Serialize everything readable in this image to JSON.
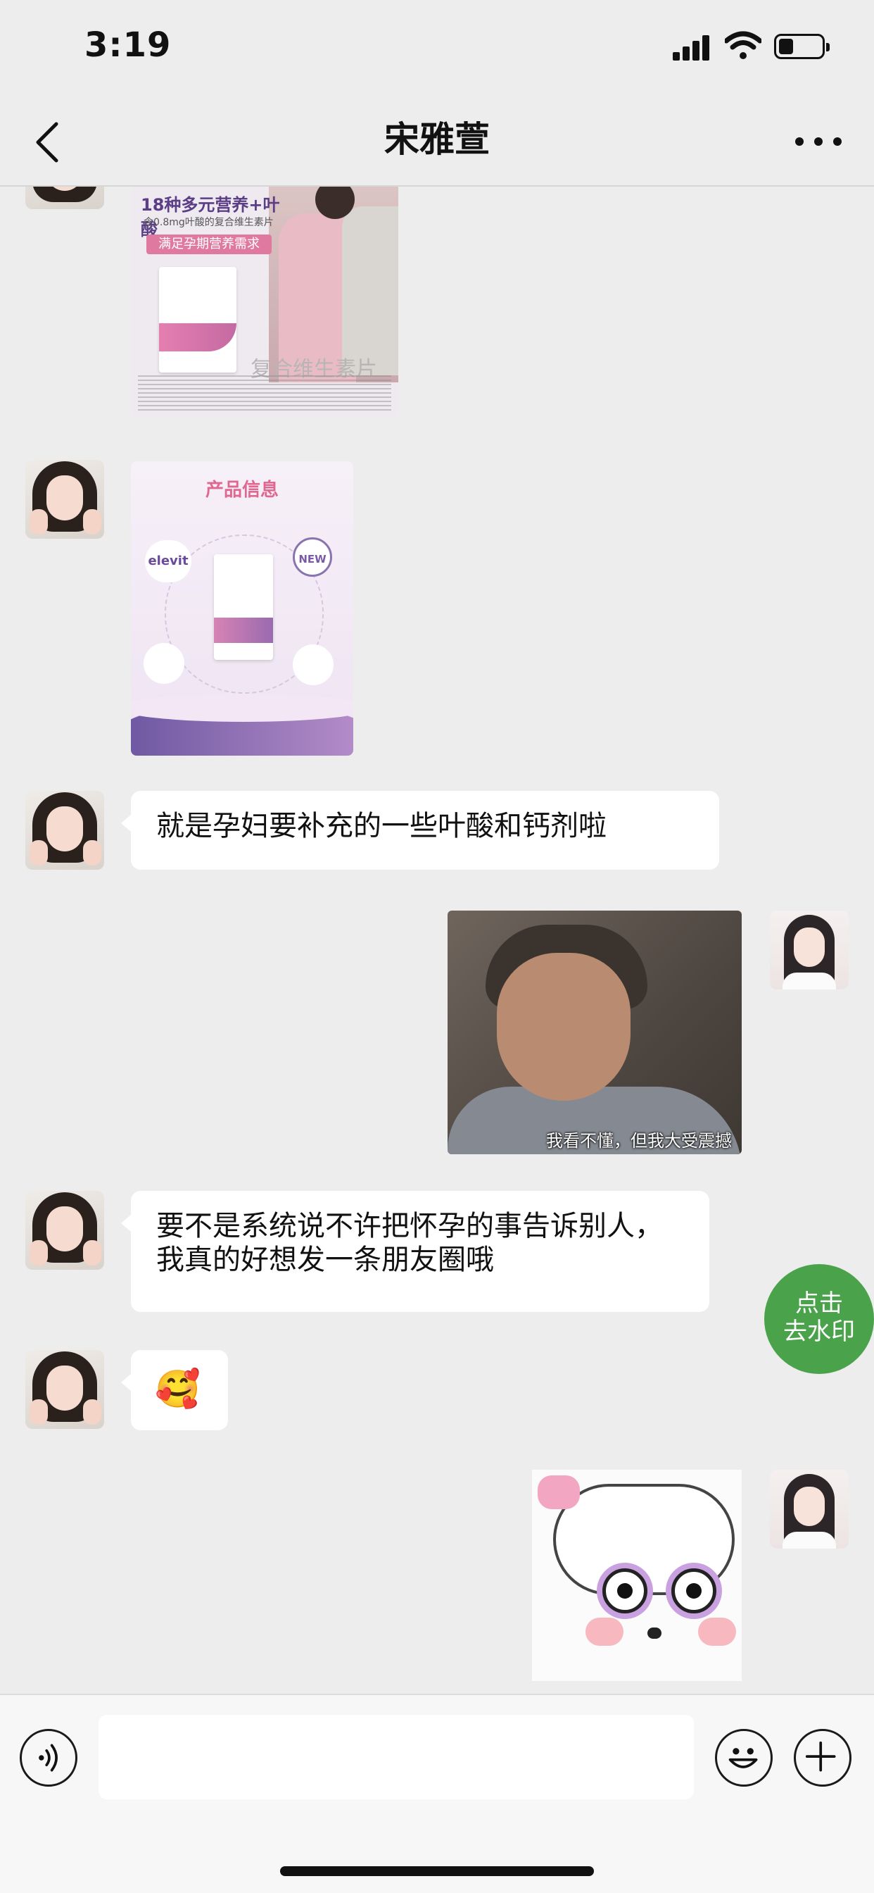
{
  "status_bar": {
    "time": "3:19"
  },
  "header": {
    "title": "宋雅萱"
  },
  "messages": [
    {
      "type": "image",
      "side": "left",
      "image": "product-image-prenatal-vitamins",
      "banner": "18种多元营养+叶酸",
      "subtitle": "含0.8mg叶酸的复合维生素片",
      "tag": "满足孕期营养需求",
      "caption": "复合维生素片"
    },
    {
      "type": "image",
      "side": "left",
      "image": "product-info-image",
      "title": "产品信息",
      "brand": "elevit",
      "badge": "NEW"
    },
    {
      "type": "text",
      "side": "left",
      "text": "就是孕妇要补充的一些叶酸和钙剂啦"
    },
    {
      "type": "image",
      "side": "right",
      "image": "meme-man-smiling",
      "caption": "我看不懂，但我大受震撼"
    },
    {
      "type": "text",
      "side": "left",
      "text": "要不是系统说不许把怀孕的事告诉别人，我真的好想发一条朋友圈哦"
    },
    {
      "type": "text",
      "side": "left",
      "text": "🥰"
    },
    {
      "type": "image",
      "side": "right",
      "image": "meme-cartoon-sheep"
    }
  ],
  "watermark_button": {
    "label_line1": "点击",
    "label_line2": "去水印"
  },
  "input_bar": {
    "placeholder": ""
  },
  "colors": {
    "background": "#ededed",
    "bubble": "#ffffff",
    "accent_green": "#4aa34b"
  },
  "icons": [
    "back-arrow-icon",
    "more-dots-icon",
    "voice-icon",
    "emoji-icon",
    "plus-icon",
    "signal-icon",
    "wifi-icon",
    "battery-icon"
  ]
}
